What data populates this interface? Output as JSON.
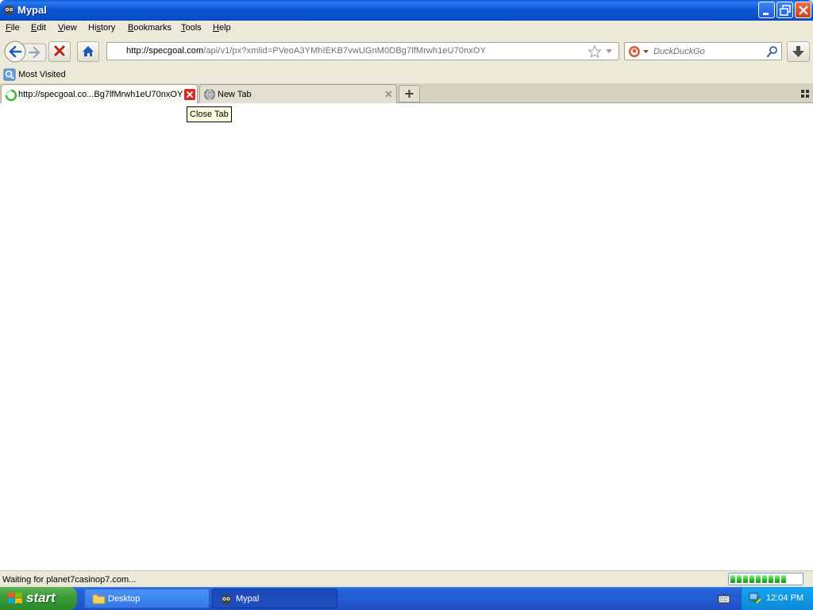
{
  "window": {
    "title": "Mypal"
  },
  "menu": [
    "File",
    "Edit",
    "View",
    "History",
    "Bookmarks",
    "Tools",
    "Help"
  ],
  "menu_underline": [
    "F",
    "E",
    "V",
    "s",
    "B",
    "T",
    "H"
  ],
  "navbar": {
    "url_host": "http://specgoal.com",
    "url_path": "/api/v1/px?xmlid=PVeoA3YMhIEKB7vwUGnM0DBg7lfMrwh1eU70nxOY",
    "search_placeholder": "DuckDuckGo"
  },
  "bookmarks": {
    "most_visited": "Most Visited"
  },
  "tabs": [
    {
      "label": "http://specgoal.co...Bg7lfMrwh1eU70nxOY",
      "active": true,
      "loading": true
    },
    {
      "label": "New Tab",
      "active": false
    }
  ],
  "tooltip": "Close Tab",
  "status": {
    "text": "Waiting for planet7casinop7.com...",
    "progress": 0.85
  },
  "taskbar": {
    "start": "start",
    "items": [
      {
        "label": "Desktop",
        "icon": "folder-icon"
      },
      {
        "label": "Mypal",
        "icon": "mypal-icon"
      }
    ],
    "clock": "12:04 PM"
  },
  "colors": {
    "titlebar": "#0b56d6",
    "chrome": "#ece9d8",
    "tab_close_active": "#d62a2a",
    "taskbar": "#2459d2",
    "start": "#3c9c39",
    "tray": "#0e8ad8"
  }
}
